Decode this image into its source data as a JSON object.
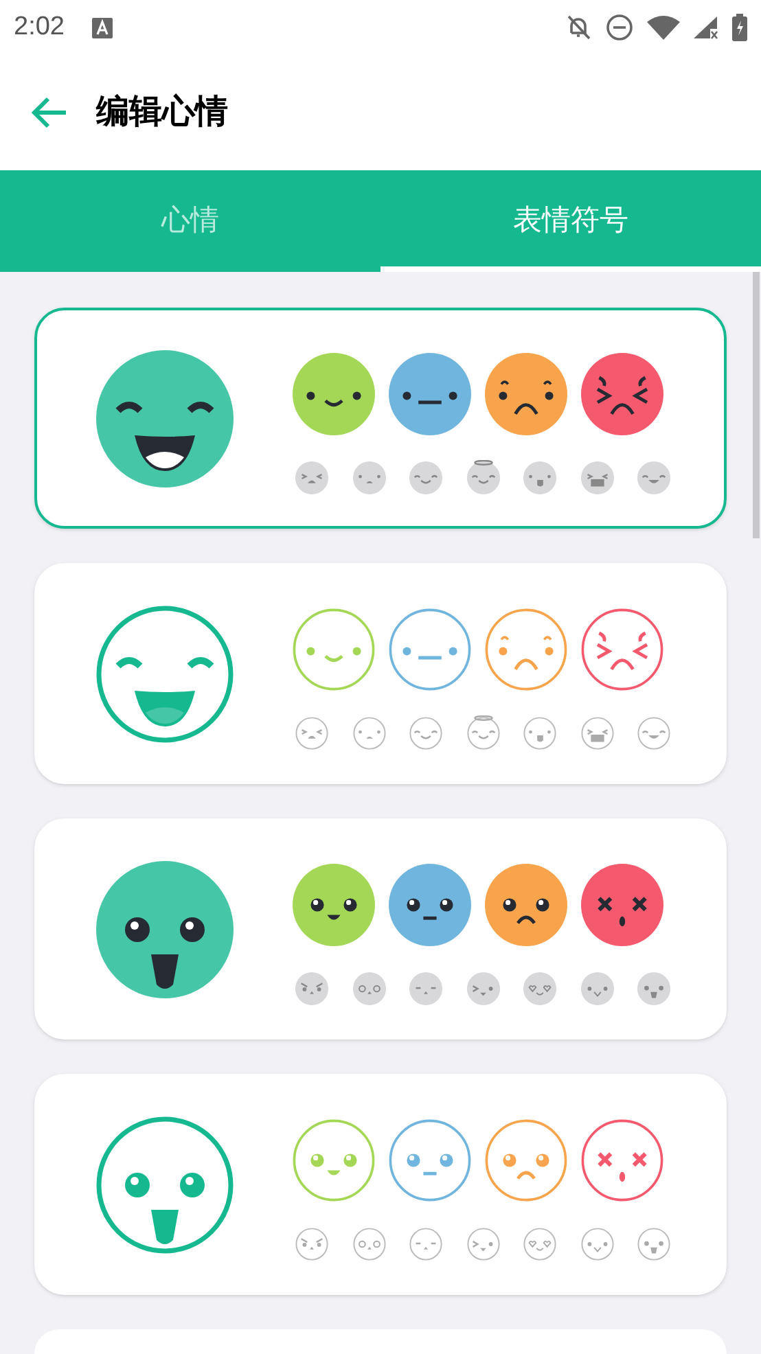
{
  "status_bar": {
    "time": "2:02"
  },
  "header": {
    "title": "编辑心情"
  },
  "tabs": [
    {
      "label": "心情",
      "selected": false
    },
    {
      "label": "表情符号",
      "selected": true
    }
  ],
  "moods": [
    {
      "color": "#a5d757"
    },
    {
      "color": "#6fb5de"
    },
    {
      "color": "#f8a44c"
    },
    {
      "color": "#f5596e"
    }
  ],
  "emoji_sets": [
    {
      "kind": "solid",
      "selected": true
    },
    {
      "kind": "ring",
      "selected": false
    },
    {
      "kind": "solidglossy",
      "selected": false
    },
    {
      "kind": "ringglossy",
      "selected": false
    },
    {
      "selected": false
    }
  ]
}
